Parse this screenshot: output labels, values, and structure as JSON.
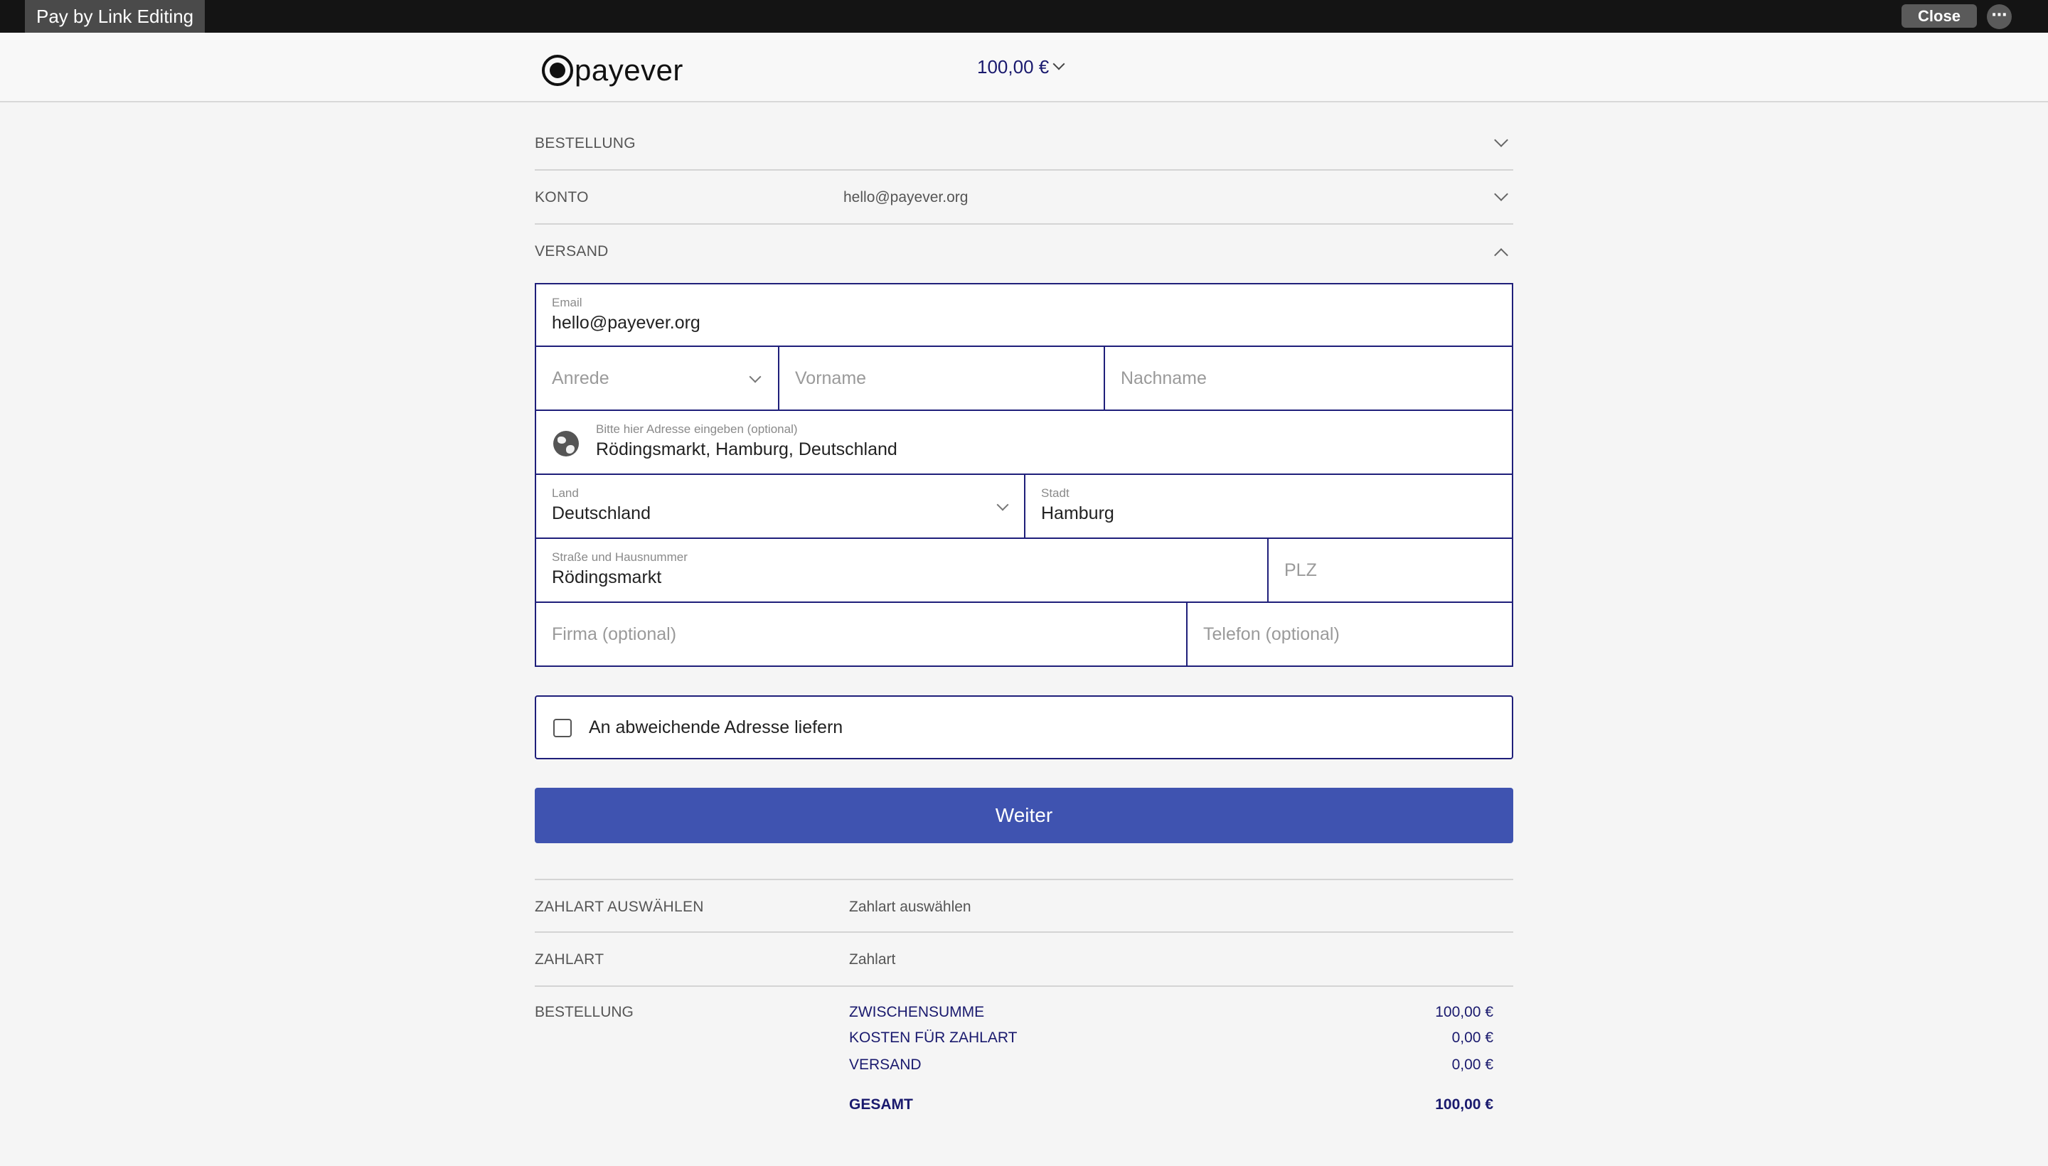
{
  "window": {
    "title": "Pay by Link Editing",
    "close_label": "Close",
    "more_icon": "⋯"
  },
  "header": {
    "logo_text": "payever",
    "amount": "100,00 €"
  },
  "sections": {
    "bestellung": {
      "label": "BESTELLUNG"
    },
    "konto": {
      "label": "KONTO",
      "value": "hello@payever.org"
    },
    "versand": {
      "label": "VERSAND"
    }
  },
  "form": {
    "email": {
      "label": "Email",
      "value": "hello@payever.org"
    },
    "anrede": {
      "placeholder": "Anrede"
    },
    "vorname": {
      "placeholder": "Vorname"
    },
    "nachname": {
      "placeholder": "Nachname"
    },
    "address": {
      "label": "Bitte hier Adresse eingeben (optional)",
      "value": "Rödingsmarkt, Hamburg, Deutschland"
    },
    "land": {
      "label": "Land",
      "value": "Deutschland"
    },
    "stadt": {
      "label": "Stadt",
      "value": "Hamburg"
    },
    "strasse": {
      "label": "Straße und Hausnummer",
      "value": "Rödingsmarkt"
    },
    "plz": {
      "placeholder": "PLZ"
    },
    "firma": {
      "placeholder": "Firma (optional)"
    },
    "telefon": {
      "placeholder": "Telefon (optional)"
    }
  },
  "checkbox": {
    "label": "An abweichende Adresse liefern",
    "checked": false
  },
  "button": {
    "label": "Weiter"
  },
  "payment": {
    "select": {
      "label": "ZAHLART AUSWÄHLEN",
      "value": "Zahlart auswählen"
    },
    "method": {
      "label": "ZAHLART",
      "value": "Zahlart"
    }
  },
  "summary": {
    "label": "BESTELLUNG",
    "lines": [
      {
        "name": "ZWISCHENSUMME",
        "value": "100,00 €"
      },
      {
        "name": "KOSTEN FÜR ZAHLART",
        "value": "0,00 €"
      },
      {
        "name": "VERSAND",
        "value": "0,00 €"
      }
    ],
    "total": {
      "name": "GESAMT",
      "value": "100,00 €"
    }
  },
  "colors": {
    "accent": "#3f53b0",
    "border": "#1f1f7a",
    "topbar": "#141414",
    "amount_text": "#1a1a6e"
  }
}
